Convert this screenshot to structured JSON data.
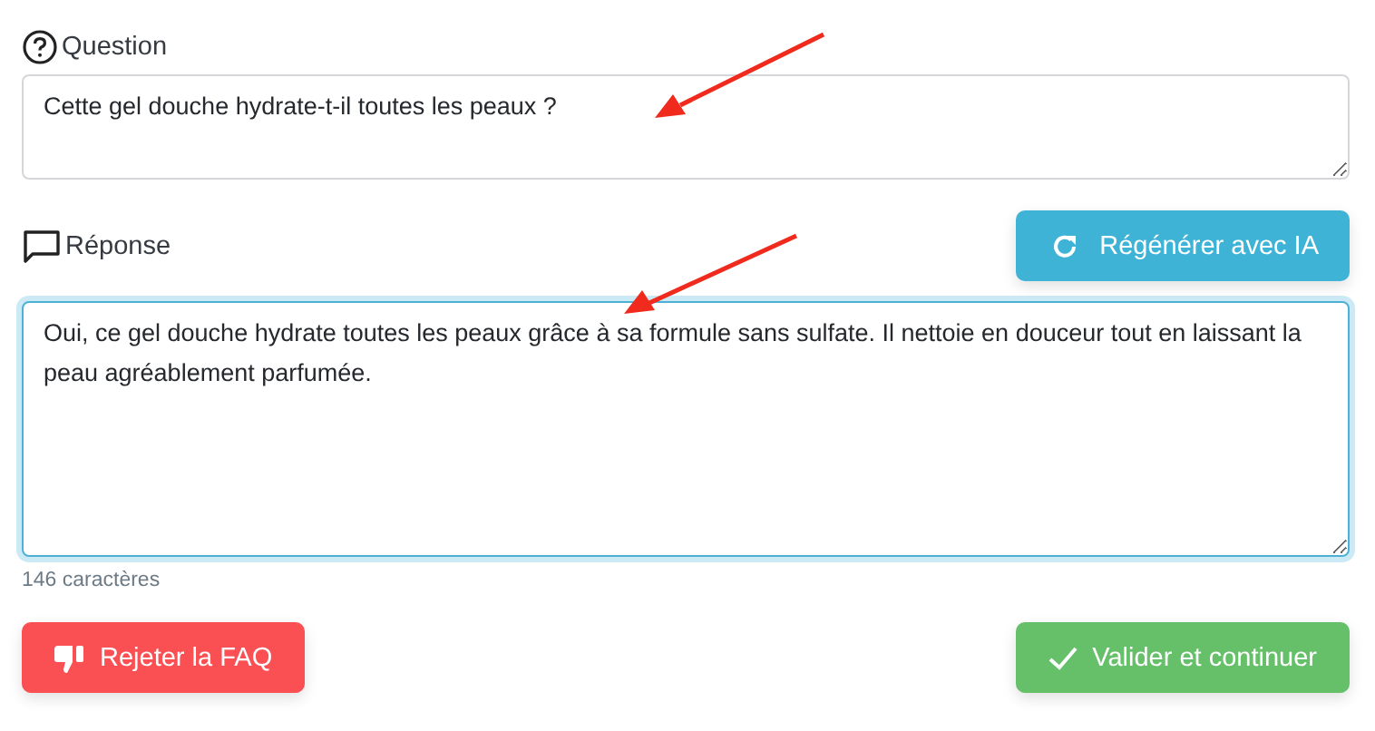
{
  "question": {
    "label": "Question",
    "value": "Cette gel douche hydrate-t-il toutes les peaux ?",
    "focused": false
  },
  "answer": {
    "label": "Réponse",
    "value": "Oui, ce gel douche hydrate toutes les peaux grâce à sa formule sans sulfate. Il nettoie en douceur tout en laissant la peau agréablement parfumée.",
    "focused": true,
    "counter": "146 caractères"
  },
  "regenerate_button": {
    "label": "Régénérer avec IA"
  },
  "buttons": [
    {
      "kind": "reject",
      "label": "Rejeter la FAQ"
    },
    {
      "kind": "accept",
      "label": "Valider et continuer"
    }
  ]
}
